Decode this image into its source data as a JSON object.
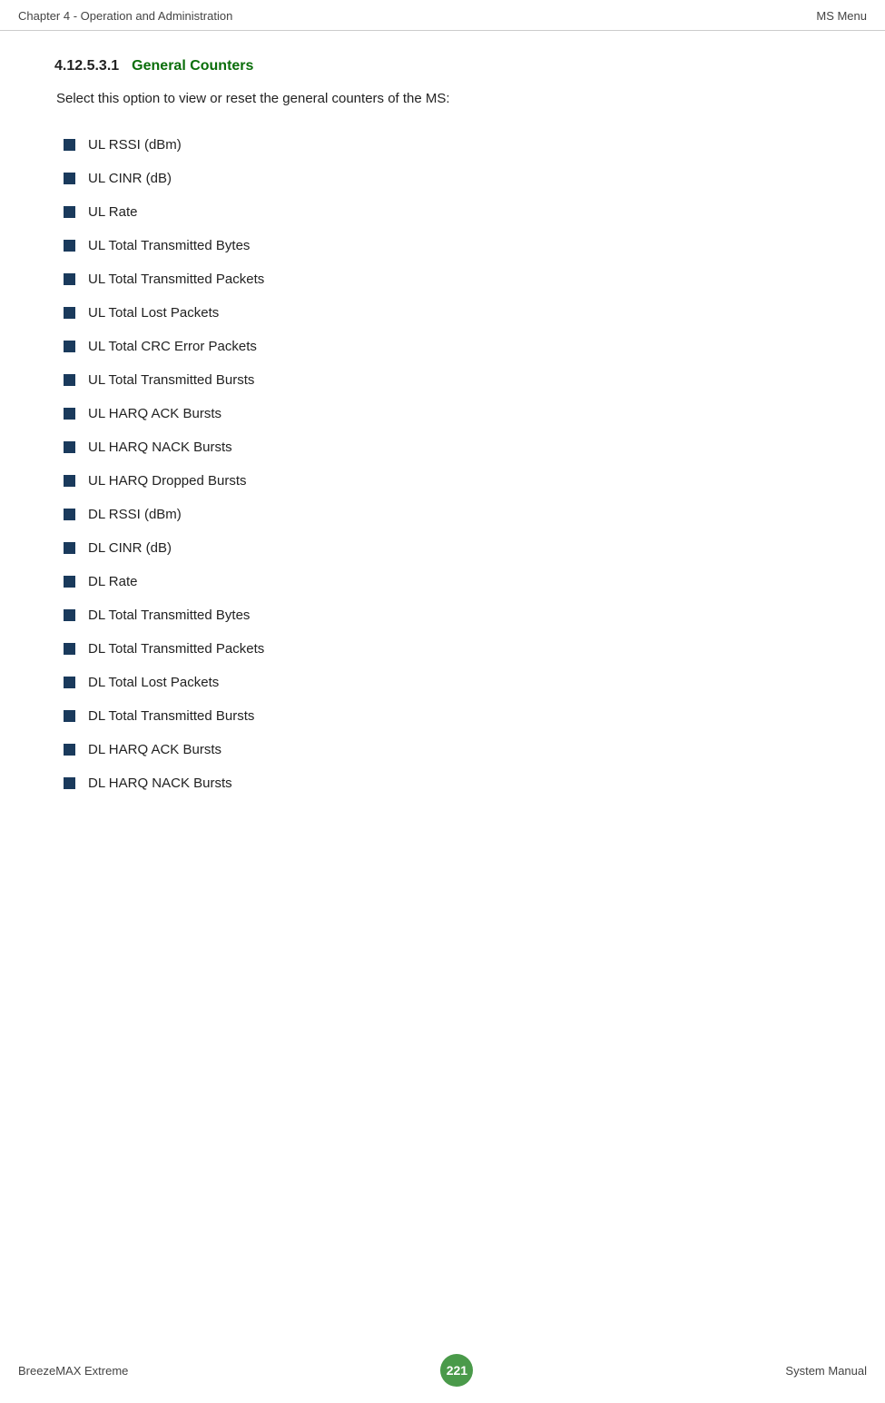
{
  "header": {
    "left": "Chapter 4 - Operation and Administration",
    "right": "MS Menu"
  },
  "section": {
    "number": "4.12.5.3.1",
    "title": "General Counters",
    "intro": "Select this option to view or reset the general counters of the MS:"
  },
  "bullets": [
    {
      "label": "UL RSSI (dBm)"
    },
    {
      "label": "UL CINR (dB)"
    },
    {
      "label": "UL Rate"
    },
    {
      "label": "UL Total Transmitted Bytes"
    },
    {
      "label": "UL Total Transmitted Packets"
    },
    {
      "label": "UL Total Lost Packets"
    },
    {
      "label": "UL Total CRC Error Packets"
    },
    {
      "label": "UL Total Transmitted Bursts"
    },
    {
      "label": "UL HARQ ACK Bursts"
    },
    {
      "label": "UL HARQ NACK Bursts"
    },
    {
      "label": "UL HARQ Dropped Bursts"
    },
    {
      "label": "DL RSSI (dBm)"
    },
    {
      "label": "DL CINR (dB)"
    },
    {
      "label": "DL Rate"
    },
    {
      "label": "DL Total Transmitted Bytes"
    },
    {
      "label": "DL Total Transmitted Packets"
    },
    {
      "label": "DL Total Lost Packets"
    },
    {
      "label": "DL Total Transmitted Bursts"
    },
    {
      "label": "DL HARQ ACK Bursts"
    },
    {
      "label": "DL HARQ NACK Bursts"
    }
  ],
  "footer": {
    "left": "BreezeMAX Extreme",
    "page_number": "221",
    "right": "System Manual"
  }
}
